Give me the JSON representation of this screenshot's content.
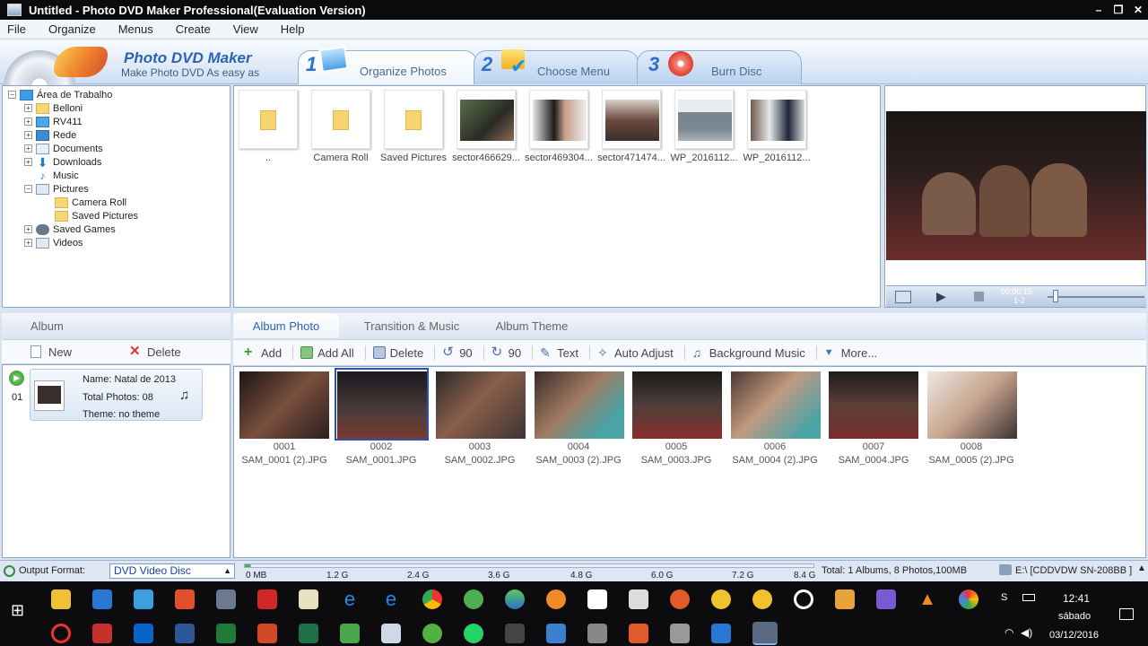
{
  "window": {
    "title": "Untitled - Photo DVD Maker Professional(Evaluation Version)",
    "min": "–",
    "restore": "❐",
    "close": "✕"
  },
  "menu": [
    "File",
    "Organize",
    "Menus",
    "Create",
    "View",
    "Help"
  ],
  "brand": {
    "title": "Photo DVD Maker",
    "subtitle": "Make Photo DVD As easy as"
  },
  "steps": [
    {
      "num": "1",
      "label": "Organize Photos"
    },
    {
      "num": "2",
      "label": "Choose Menu"
    },
    {
      "num": "3",
      "label": "Burn Disc"
    }
  ],
  "tree": {
    "root": "Área de Trabalho",
    "items": [
      {
        "label": "Belloni",
        "exp": "+",
        "icon": "folder"
      },
      {
        "label": "RV411",
        "exp": "+",
        "icon": "pc"
      },
      {
        "label": "Rede",
        "exp": "+",
        "icon": "network"
      },
      {
        "label": "Documents",
        "exp": "+",
        "icon": "docs"
      },
      {
        "label": "Downloads",
        "exp": "+",
        "icon": "download"
      },
      {
        "label": "Music",
        "exp": "",
        "icon": "music"
      },
      {
        "label": "Pictures",
        "exp": "−",
        "icon": "pictures"
      },
      {
        "label": "Camera Roll",
        "exp": "",
        "icon": "folder"
      },
      {
        "label": "Saved Pictures",
        "exp": "",
        "icon": "folder"
      },
      {
        "label": "Saved Games",
        "exp": "+",
        "icon": "games"
      },
      {
        "label": "Videos",
        "exp": "+",
        "icon": "video"
      }
    ]
  },
  "browser": {
    "items": [
      {
        "label": "..",
        "type": "folder"
      },
      {
        "label": "Camera Roll",
        "type": "folder"
      },
      {
        "label": "Saved Pictures",
        "type": "folder"
      },
      {
        "label": "sector466629...",
        "type": "photo",
        "color": "#3b4a2e"
      },
      {
        "label": "sector469304...",
        "type": "photo",
        "color": "#2a2625"
      },
      {
        "label": "sector471474...",
        "type": "photo",
        "color": "#5c4a45"
      },
      {
        "label": "WP_2016112...",
        "type": "photo",
        "color": "#8b9aa5"
      },
      {
        "label": "WP_2016112...",
        "type": "photo",
        "color": "#6b6f77"
      }
    ]
  },
  "player": {
    "time": "00:00:15",
    "counter": "1-2"
  },
  "album": {
    "tab": "Album",
    "new_label": "New",
    "delete_label": "Delete",
    "card": {
      "index": "01",
      "name": "Name: Natal de 2013",
      "total": "Total Photos: 08",
      "theme": "Theme: no theme"
    }
  },
  "tabs": [
    "Album Photo",
    "Transition & Music",
    "Album Theme"
  ],
  "toolbar": [
    {
      "label": "Add",
      "icon": "add-icon",
      "color": "#3a9b3a"
    },
    {
      "label": "Add All",
      "icon": "add-all-icon",
      "color": "#3a9b3a"
    },
    {
      "label": "Delete",
      "icon": "trash-icon",
      "color": "#5577aa"
    },
    {
      "label": "90",
      "icon": "rotate-left-icon",
      "color": "#4a6fb0"
    },
    {
      "label": "90",
      "icon": "rotate-right-icon",
      "color": "#4a6fb0"
    },
    {
      "label": "Text",
      "icon": "text-icon",
      "color": "#4a6fb0"
    },
    {
      "label": "Auto Adjust",
      "icon": "magic-wand-icon",
      "color": "#4a6fb0"
    },
    {
      "label": "Background Music",
      "icon": "music-icon",
      "color": "#4a6fb0"
    },
    {
      "label": "More...",
      "icon": "dropdown-icon",
      "color": "#4a6fb0"
    }
  ],
  "photos": [
    {
      "num": "0001",
      "file": "SAM_0001 (2).JPG",
      "color": "#3a2a26"
    },
    {
      "num": "0002",
      "file": "SAM_0001.JPG",
      "color": "#2c2e36"
    },
    {
      "num": "0003",
      "file": "SAM_0002.JPG",
      "color": "#3b3130"
    },
    {
      "num": "0004",
      "file": "SAM_0003 (2).JPG",
      "color": "#4e3a33"
    },
    {
      "num": "0005",
      "file": "SAM_0003.JPG",
      "color": "#3d2b2a"
    },
    {
      "num": "0006",
      "file": "SAM_0004 (2).JPG",
      "color": "#5b4038"
    },
    {
      "num": "0007",
      "file": "SAM_0004.JPG",
      "color": "#34292a"
    },
    {
      "num": "0008",
      "file": "SAM_0005 (2).JPG",
      "color": "#d7d0c8"
    }
  ],
  "status": {
    "output_label": "Output Format:",
    "output_value": "DVD Video Disc",
    "scale": [
      "0 MB",
      "1.2 G",
      "2.4 G",
      "3.6 G",
      "4.8 G",
      "6.0 G",
      "7.2 G",
      "8.4 G"
    ],
    "total": "Total: 1 Albums, 8 Photos,100MB",
    "drive": "E:\\ [CDDVDW SN-208BB ]"
  },
  "taskbar": {
    "time": "12:41",
    "day": "sábado",
    "date": "03/12/2016"
  }
}
